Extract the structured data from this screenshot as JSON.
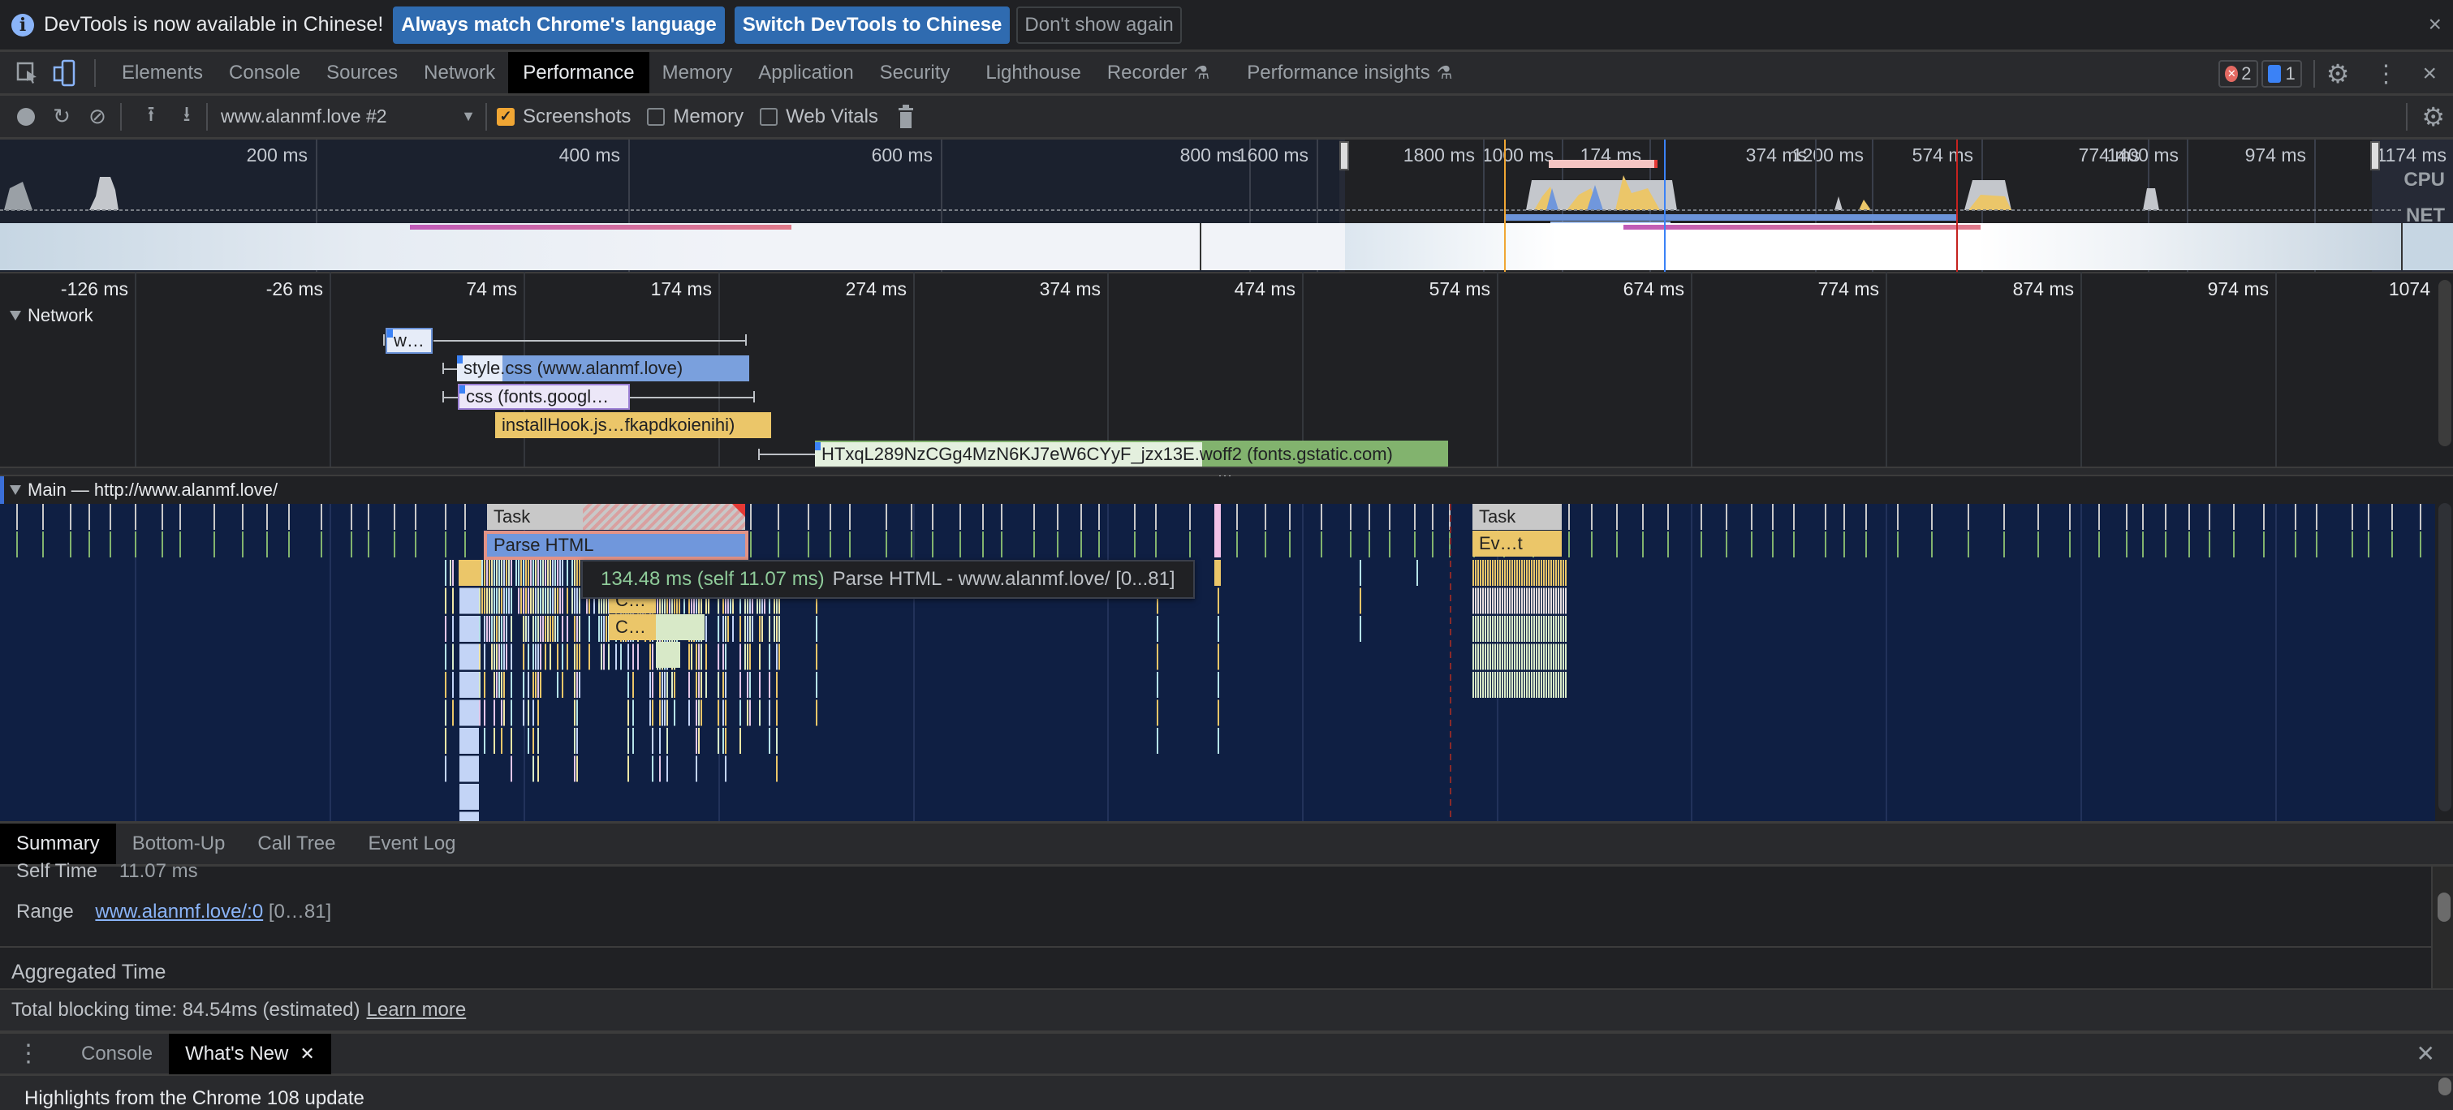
{
  "infobar": {
    "message": "DevTools is now available in Chinese!",
    "buttons": [
      "Always match Chrome's language",
      "Switch DevTools to Chinese",
      "Don't show again"
    ],
    "close_label": "×"
  },
  "tabbar": {
    "tabs": [
      "Elements",
      "Console",
      "Sources",
      "Network",
      "Performance",
      "Memory",
      "Application",
      "Security",
      "Lighthouse",
      "Recorder",
      "Performance insights"
    ],
    "active_tab": "Performance",
    "error_count": "2",
    "message_count": "1",
    "close_label": "×"
  },
  "toolbar": {
    "recording_select": "www.alanmf.love #2",
    "screenshots_label": "Screenshots",
    "screenshots_checked": true,
    "memory_label": "Memory",
    "memory_checked": false,
    "webvitals_label": "Web Vitals",
    "webvitals_checked": false
  },
  "overview": {
    "ticks": [
      "200 ms",
      "400 ms",
      "600 ms",
      "800 ms",
      "1000 ms",
      "1200 ms",
      "1400 ms",
      "1600 ms",
      "1800 ms",
      "174 ms",
      "374 ms",
      "574 ms",
      "774 ms",
      "974 ms",
      "1174 ms"
    ],
    "cpu_label": "CPU",
    "net_label": "NET"
  },
  "ruler": {
    "ticks": [
      "-126 ms",
      "-26 ms",
      "74 ms",
      "174 ms",
      "274 ms",
      "374 ms",
      "474 ms",
      "574 ms",
      "674 ms",
      "774 ms",
      "874 ms",
      "974 ms",
      "1074"
    ]
  },
  "network": {
    "title": "Network",
    "requests": [
      {
        "label": "w…",
        "type": "document"
      },
      {
        "label": "style.css (www.alanmf.love)",
        "type": "stylesheet"
      },
      {
        "label": "css (fonts.googl…",
        "type": "stylesheet-font"
      },
      {
        "label": "installHook.js…fkapdkoienihi)",
        "type": "script"
      },
      {
        "label": "HTxqL289NzCGg4MzN6KJ7eW6CYyF_jzx13E.woff2 (fonts.gstatic.com)",
        "type": "font"
      }
    ]
  },
  "main": {
    "title": "Main — http://www.alanmf.love/",
    "blocks": [
      {
        "label": "Task",
        "kind": "task"
      },
      {
        "label": "Parse HTML",
        "kind": "parse"
      },
      {
        "label": "C…",
        "kind": "script"
      },
      {
        "label": "C…",
        "kind": "script"
      },
      {
        "label": "Task",
        "kind": "task"
      },
      {
        "label": "Ev…t",
        "kind": "script"
      }
    ],
    "tooltip": {
      "time": "134.48 ms (self 11.07 ms)",
      "description": "Parse HTML - www.alanmf.love/ [0...81]"
    }
  },
  "details": {
    "tabs": [
      "Summary",
      "Bottom-Up",
      "Call Tree",
      "Event Log"
    ],
    "active_tab": "Summary",
    "self_time_label": "Self Time",
    "self_time_value": "11.07 ms",
    "range_label": "Range",
    "range_link": "www.alanmf.love/:0",
    "range_suffix": "[0…81]",
    "aggregated_label": "Aggregated Time",
    "tbt_text": "Total blocking time: 84.54ms (estimated)",
    "learn_more": "Learn more"
  },
  "drawer": {
    "tabs": [
      "Console",
      "What's New"
    ],
    "active_tab": "What's New",
    "content": "Highlights from the Chrome 108 update"
  },
  "colors": {
    "accent_blue": "#2f6bb0",
    "flame_bg": "#0f1f43",
    "task_gray": "#c8c8c8",
    "script_yellow": "#ebc669",
    "parse_blue": "#7097dc",
    "font_green": "#82b36e"
  }
}
